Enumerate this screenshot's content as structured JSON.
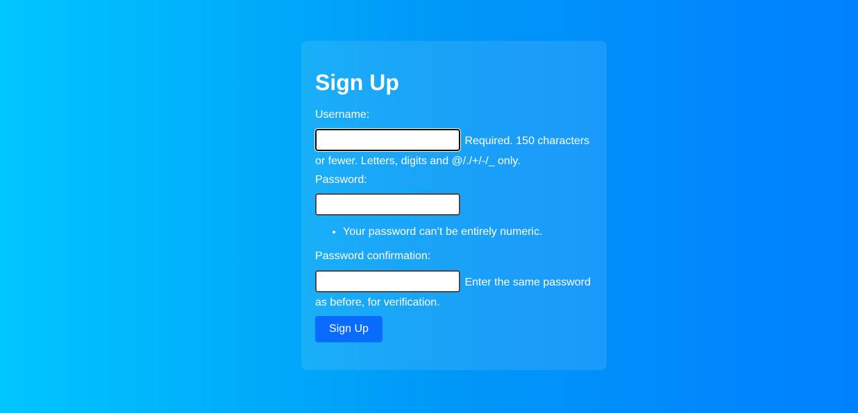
{
  "form": {
    "title": "Sign Up",
    "username": {
      "label": "Username:",
      "value": "",
      "help": "Required. 150 characters or fewer. Letters, digits and @/./+/-/_ only."
    },
    "password": {
      "label": "Password:",
      "value": "",
      "help_items": [
        "Your password can’t be entirely numeric."
      ]
    },
    "password_confirmation": {
      "label": "Password confirmation:",
      "value": "",
      "help": "Enter the same password as before, for verification."
    },
    "submit_label": "Sign Up"
  },
  "colors": {
    "gradient_start": "#00c6ff",
    "gradient_end": "#0080ff",
    "button": "#0a6cff"
  }
}
